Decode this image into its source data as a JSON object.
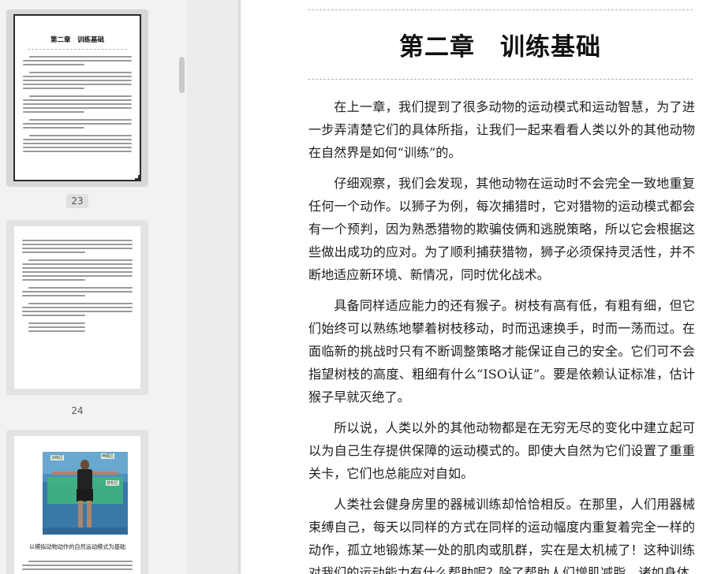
{
  "sidebar": {
    "thumbnails": [
      {
        "page_label": "23",
        "selected": true,
        "title": "第二章　训练基础"
      },
      {
        "page_label": "24",
        "selected": false
      },
      {
        "page_label": "",
        "selected": false,
        "figure_labels": [
          "训练区",
          "伸展区",
          "放松区"
        ],
        "caption": "以模拟动物动作的自然运动模式为基础"
      }
    ]
  },
  "document": {
    "chapter_title": "第二章　训练基础",
    "paragraphs": [
      "在上一章，我们提到了很多动物的运动模式和运动智慧，为了进一步弄清楚它们的具体所指，让我们一起来看看人类以外的其他动物在自然界是如何“训练”的。",
      "仔细观察，我们会发现，其他动物在运动时不会完全一致地重复任何一个动作。以狮子为例，每次捕猎时，它对猎物的运动模式都会有一个预判，因为熟悉猎物的欺骗伎俩和逃脱策略，所以它会根据这些做出成功的应对。为了顺利捕获猎物，狮子必须保持灵活性，并不断地适应新环境、新情况，同时优化战术。",
      "具备同样适应能力的还有猴子。树枝有高有低，有粗有细，但它们始终可以熟练地攀着树枝移动，时而迅速换手，时而一荡而过。在面临新的挑战时只有不断调整策略才能保证自己的安全。它们可不会指望树枝的高度、粗细有什么“ISO认证”。要是依赖认证标准，估计猴子早就灭绝了。",
      "所以说，人类以外的其他动物都是在无穷无尽的变化中建立起可以为自己生存提供保障的运动模式的。即使大自然为它们设置了重重关卡，它们也总能应对自如。",
      "人类社会健身房里的器械训练却恰恰相反。在那里，人们用器械束缚自己，每天以同样的方式在同样的运动幅度内重复着完全一样的动作，孤立地锻炼某一处的肌肉或肌群，实在是太机械了！这种训练对我们的运动能力有什么帮助呢？除了帮助人们增肌减脂，诸如身体"
    ]
  }
}
